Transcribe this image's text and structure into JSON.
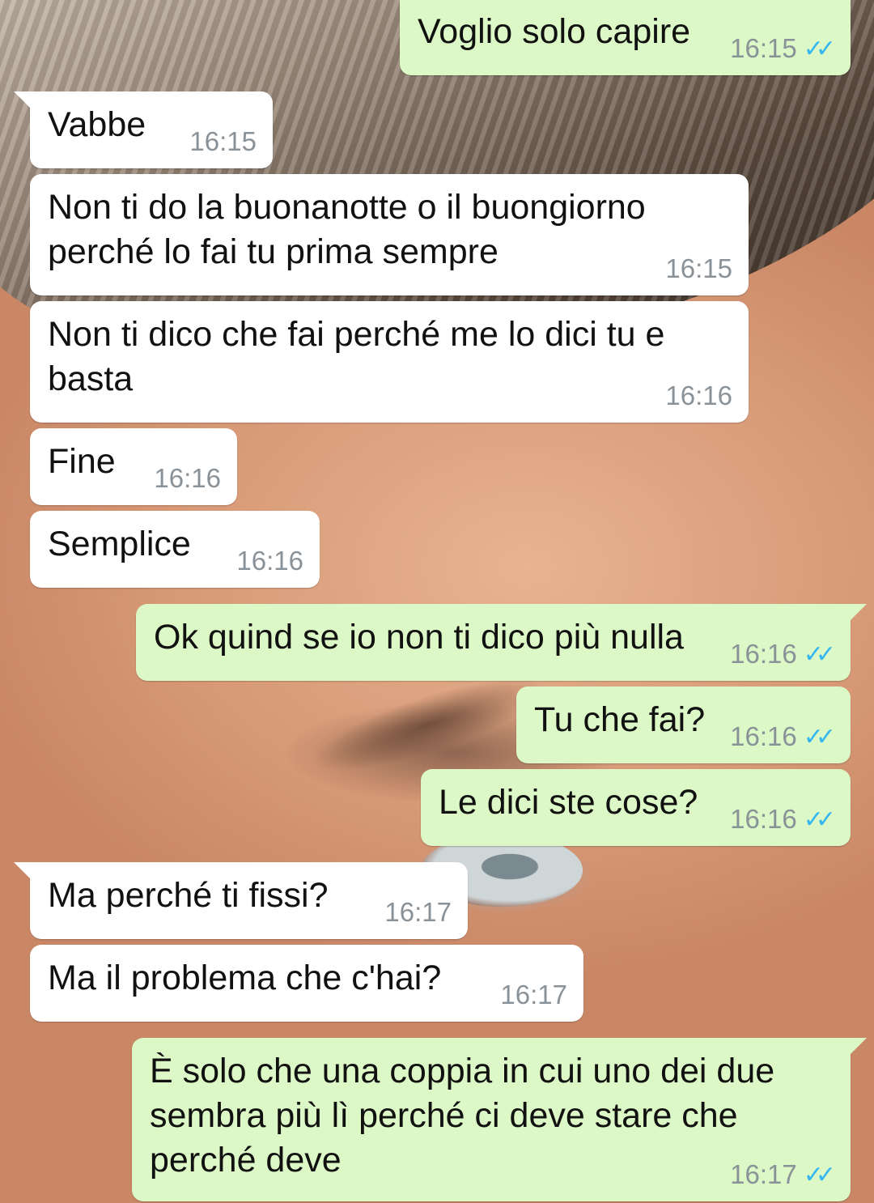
{
  "colors": {
    "outgoing_bubble": "#dcf8c6",
    "incoming_bubble": "#ffffff",
    "read_ticks": "#34b7f1",
    "time_text": "#8a9299"
  },
  "messages": [
    {
      "dir": "out",
      "text": "Voglio solo capire",
      "time": "16:15",
      "status": "read"
    },
    {
      "dir": "in",
      "text": "Vabbe",
      "time": "16:15"
    },
    {
      "dir": "in",
      "text": "Non ti do la buonanotte o il buongiorno\nperché lo fai tu prima sempre",
      "time": "16:15"
    },
    {
      "dir": "in",
      "text": "Non ti dico che fai perché me lo dici tu e\nbasta",
      "time": "16:16"
    },
    {
      "dir": "in",
      "text": "Fine",
      "time": "16:16"
    },
    {
      "dir": "in",
      "text": "Semplice",
      "time": "16:16"
    },
    {
      "dir": "out",
      "text": "Ok quind se io non ti dico più nulla",
      "time": "16:16",
      "status": "read"
    },
    {
      "dir": "out",
      "text": "Tu che fai?",
      "time": "16:16",
      "status": "read"
    },
    {
      "dir": "out",
      "text": "Le dici ste cose?",
      "time": "16:16",
      "status": "read"
    },
    {
      "dir": "in",
      "text": "Ma perché ti fissi?",
      "time": "16:17"
    },
    {
      "dir": "in",
      "text": "Ma il problema che c'hai?",
      "time": "16:17"
    },
    {
      "dir": "out",
      "text": "È solo che una coppia in cui uno dei due\nsembra più lì perché ci deve stare che\nperché deve",
      "time": "16:17",
      "status": "read"
    }
  ],
  "icons": {
    "read_receipt": "double-check-icon"
  }
}
